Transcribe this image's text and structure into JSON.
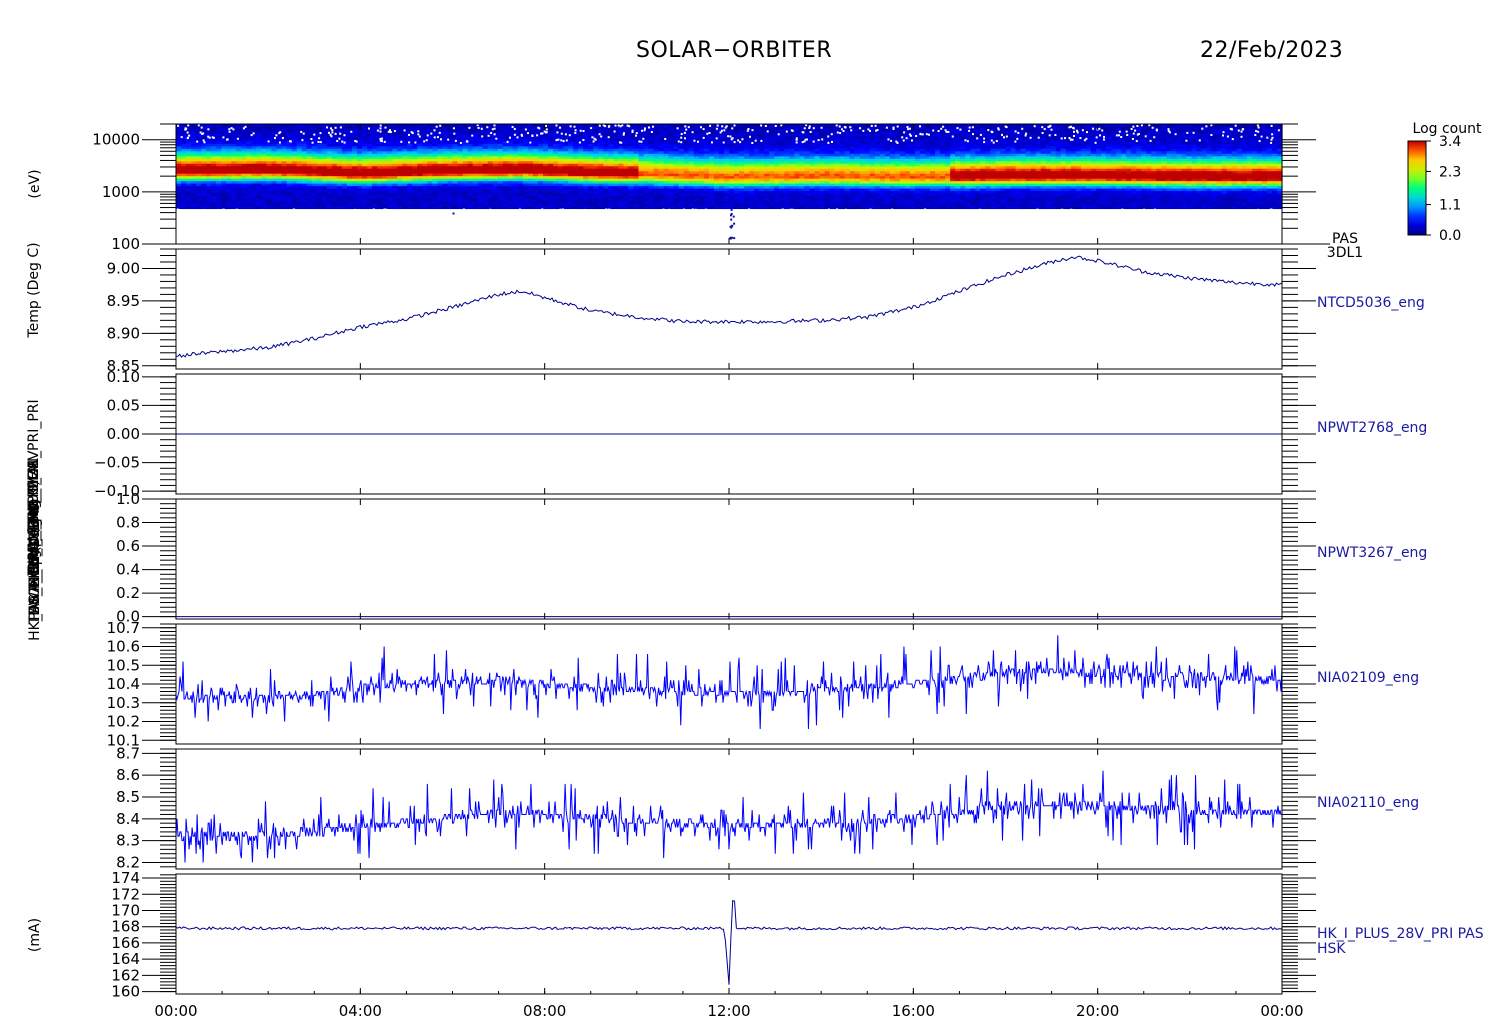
{
  "header": {
    "mission": "SOLAR−ORBITER",
    "date": "22/Feb/2023"
  },
  "colors": {
    "axis": "#000000",
    "trace": "#00008b",
    "trace_bright": "#0000ff",
    "label": "#1a1aa0"
  },
  "chart_data": [
    {
      "type": "heatmap",
      "panel": "pas-spectrogram",
      "ylabel": "(eV)",
      "yscale": "log",
      "ylim": [
        100,
        20000
      ],
      "yticks": [
        "10000",
        "1000",
        "100"
      ],
      "ytick_values": [
        10000,
        1000,
        100
      ],
      "right_label": [
        "PAS",
        "3DL1"
      ],
      "colorbar": {
        "title": "Log count",
        "ticks": [
          "3.4",
          "2.3",
          "1.1",
          "0.0"
        ],
        "range": [
          0.0,
          3.4
        ]
      },
      "peak_energy_track": {
        "x_hours": [
          0,
          2,
          4,
          6,
          7.5,
          9,
          10,
          12,
          14,
          16,
          18,
          20,
          22,
          24
        ],
        "energy_eV": [
          2500,
          2600,
          2200,
          2500,
          2600,
          2300,
          2200,
          1900,
          2000,
          1900,
          2000,
          2000,
          1900,
          1900
        ]
      }
    },
    {
      "type": "line",
      "panel": "ntcd5036",
      "ylabel": "Temp (Deg C)",
      "series_label": "NTCD5036_eng",
      "ylim": [
        8.845,
        9.03
      ],
      "yticks": [
        "9.00",
        "8.95",
        "8.90",
        "8.85"
      ],
      "ytick_values": [
        9.0,
        8.95,
        8.9,
        8.85
      ],
      "x_hours": [
        0,
        1,
        2,
        3,
        4,
        5,
        6,
        7,
        7.5,
        8,
        9,
        10,
        11,
        12,
        13,
        14,
        15,
        16,
        17,
        18,
        19,
        19.5,
        20,
        21,
        22,
        23,
        24
      ],
      "y": [
        8.865,
        8.872,
        8.878,
        8.892,
        8.91,
        8.922,
        8.94,
        8.96,
        8.965,
        8.955,
        8.935,
        8.925,
        8.918,
        8.918,
        8.918,
        8.92,
        8.925,
        8.94,
        8.965,
        8.99,
        9.01,
        9.018,
        9.012,
        8.995,
        8.985,
        8.978,
        8.975
      ]
    },
    {
      "type": "line",
      "panel": "npwt2768",
      "ylabel": "",
      "series_label": "NPWT2768_eng",
      "ylim": [
        -0.105,
        0.105
      ],
      "yticks": [
        "0.10",
        "0.05",
        "0.00",
        "−0.05",
        "−0.10"
      ],
      "ytick_values": [
        0.1,
        0.05,
        0.0,
        -0.05,
        -0.1
      ],
      "x_hours": [
        0,
        24
      ],
      "y": [
        0.0,
        0.0
      ]
    },
    {
      "type": "line",
      "panel": "npwt3267",
      "ylabel": "",
      "series_label": "NPWT3267_eng",
      "ylim": [
        -0.02,
        1.0
      ],
      "yticks": [
        "1.0",
        "0.8",
        "0.6",
        "0.4",
        "0.2",
        "0.0"
      ],
      "ytick_values": [
        1.0,
        0.8,
        0.6,
        0.4,
        0.2,
        0.0
      ],
      "x_hours": [
        0,
        24
      ],
      "y": [
        0.0,
        0.0
      ]
    },
    {
      "type": "line",
      "panel": "nia02109",
      "ylabel": "",
      "series_label": "NIA02109_eng",
      "ylim": [
        10.08,
        10.72
      ],
      "yticks": [
        "10.7",
        "10.6",
        "10.5",
        "10.4",
        "10.3",
        "10.2",
        "10.1"
      ],
      "ytick_values": [
        10.7,
        10.6,
        10.5,
        10.4,
        10.3,
        10.2,
        10.1
      ],
      "x_hours": [
        0,
        1,
        2,
        3,
        4,
        5,
        6,
        7,
        8,
        9,
        10,
        11,
        12,
        13,
        14,
        15,
        16,
        17,
        18,
        19,
        20,
        21,
        22,
        23,
        24
      ],
      "y": [
        10.33,
        10.33,
        10.33,
        10.34,
        10.39,
        10.4,
        10.41,
        10.42,
        10.4,
        10.38,
        10.37,
        10.36,
        10.35,
        10.35,
        10.36,
        10.38,
        10.41,
        10.43,
        10.46,
        10.47,
        10.46,
        10.45,
        10.44,
        10.43,
        10.42
      ],
      "noise_amplitude": 0.09
    },
    {
      "type": "line",
      "panel": "nia02110",
      "ylabel": "",
      "series_label": "NIA02110_eng",
      "ylim": [
        8.17,
        8.72
      ],
      "yticks": [
        "8.7",
        "8.6",
        "8.5",
        "8.4",
        "8.3",
        "8.2"
      ],
      "ytick_values": [
        8.7,
        8.6,
        8.5,
        8.4,
        8.3,
        8.2
      ],
      "x_hours": [
        0,
        1,
        2,
        3,
        4,
        5,
        6,
        7,
        8,
        9,
        10,
        11,
        12,
        13,
        14,
        15,
        16,
        17,
        18,
        19,
        20,
        21,
        22,
        23,
        24
      ],
      "y": [
        8.32,
        8.32,
        8.33,
        8.34,
        8.37,
        8.38,
        8.41,
        8.43,
        8.42,
        8.4,
        8.39,
        8.38,
        8.37,
        8.37,
        8.38,
        8.39,
        8.41,
        8.43,
        8.46,
        8.47,
        8.46,
        8.45,
        8.44,
        8.43,
        8.43
      ],
      "noise_amplitude": 0.08
    },
    {
      "type": "line",
      "panel": "hk-i-plus-28v",
      "ylabel": "(mA)",
      "series_label": [
        "HK_I_PLUS_28V_PRI PAS",
        "HSK"
      ],
      "ylim": [
        159.7,
        174.5
      ],
      "yticks": [
        "174",
        "172",
        "170",
        "168",
        "166",
        "164",
        "162",
        "160"
      ],
      "ytick_values": [
        174,
        172,
        170,
        168,
        166,
        164,
        162,
        160
      ],
      "x_hours": [
        0,
        11.9,
        12.0,
        12.05,
        12.1,
        12.15,
        24
      ],
      "y": [
        167.8,
        167.8,
        161.0,
        168.0,
        173.6,
        167.8,
        167.8
      ]
    }
  ],
  "x_axis": {
    "range_hours": [
      0,
      24
    ],
    "tick_labels": [
      "00:00",
      "04:00",
      "08:00",
      "12:00",
      "16:00",
      "20:00",
      "00:00"
    ],
    "tick_hours": [
      0,
      4,
      8,
      12,
      16,
      20,
      24
    ]
  },
  "overlapping_ylabels": [
    "Log count",
    "Temp (Deg C)",
    "Temp (Deg C)",
    "SWA_EDU_TEMP",
    "SWA_TEMP_LEM",
    "PAS_EIRE_CUR",
    "HK_I_PLUS_28V",
    "TDS_MON_1",
    "THERMAL",
    "HK_IMON_PRI",
    "PDM_HK_IMON_PRI_PRI"
  ]
}
